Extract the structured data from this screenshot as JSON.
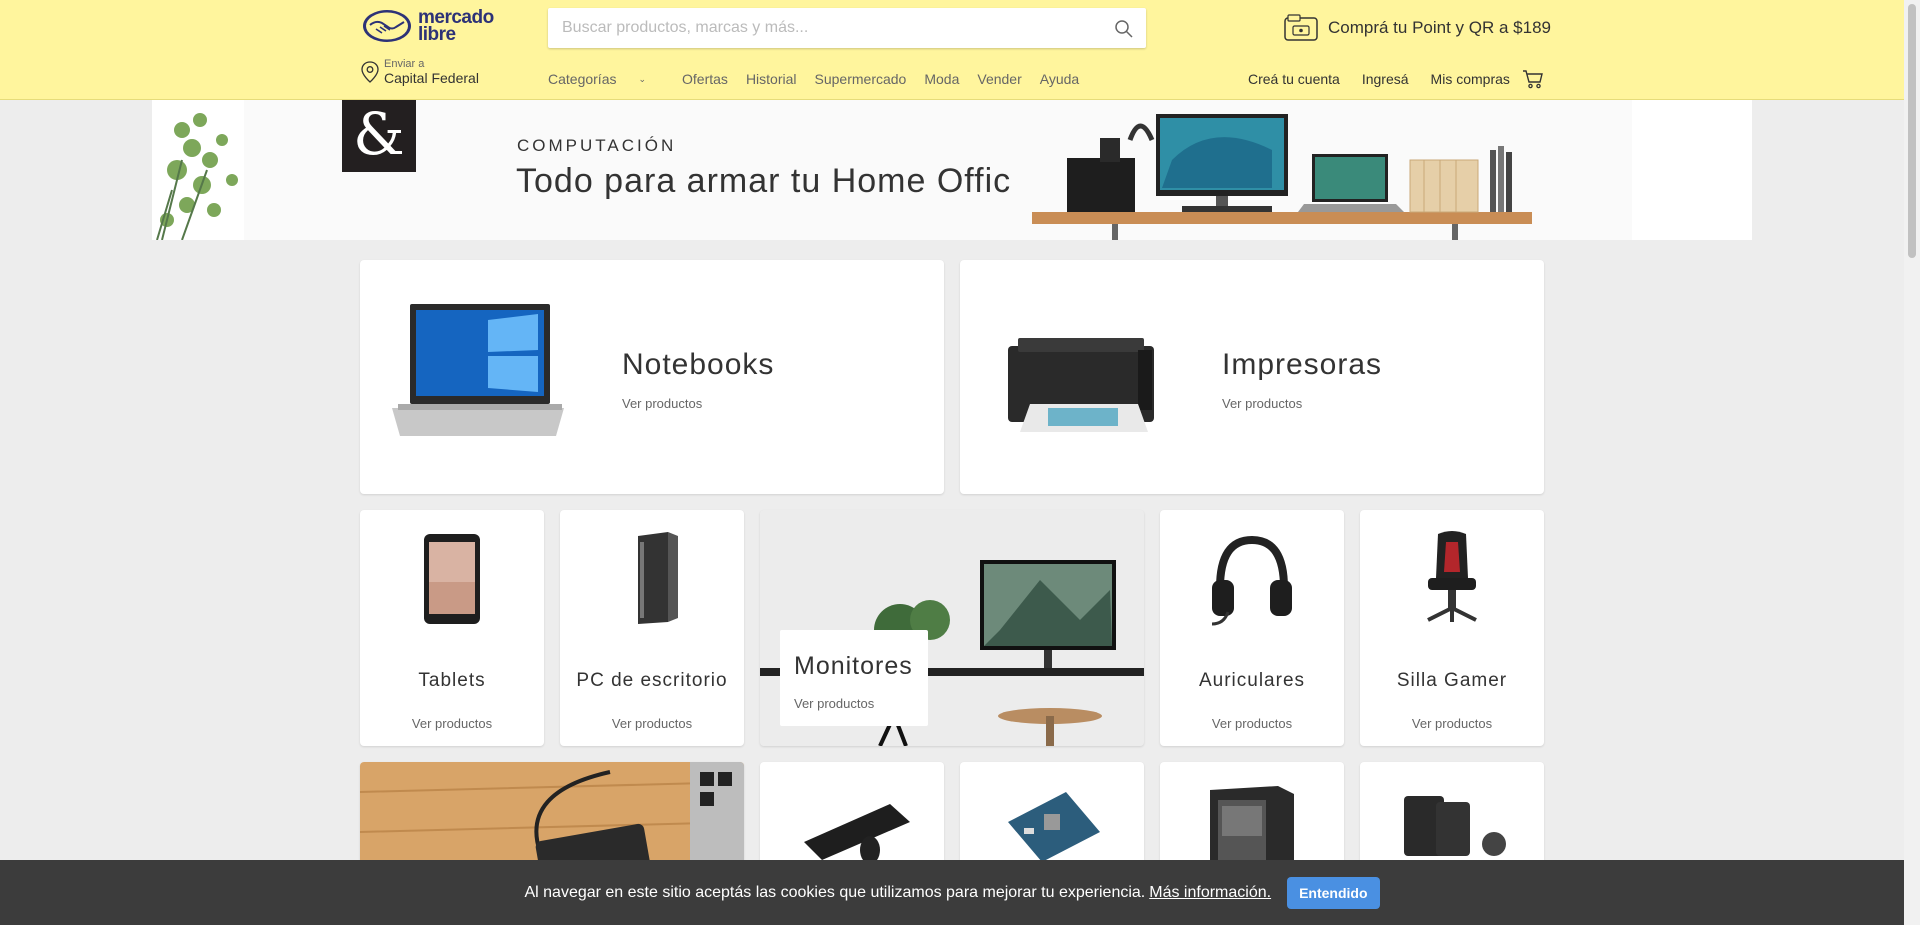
{
  "header": {
    "logo_line1": "mercado",
    "logo_line2": "libre",
    "search_placeholder": "Buscar productos, marcas y más...",
    "promo": "Comprá tu Point y QR a $189",
    "location_label": "Enviar a",
    "location_city": "Capital Federal",
    "nav": [
      "Categorías",
      "Ofertas",
      "Historial",
      "Supermercado",
      "Moda",
      "Vender",
      "Ayuda"
    ],
    "user_nav": [
      "Creá tu cuenta",
      "Ingresá",
      "Mis compras"
    ],
    "brand_color": "#fff59d"
  },
  "banner": {
    "kicker": "COMPUTACIÓN",
    "title": "Todo para armar tu Home Office",
    "ampersand": "&"
  },
  "cards": {
    "link_label": "Ver productos",
    "large": [
      {
        "title": "Notebooks",
        "icon": "laptop-icon"
      },
      {
        "title": "Impresoras",
        "icon": "printer-icon"
      }
    ],
    "small": [
      {
        "title": "Tablets",
        "icon": "tablet-icon"
      },
      {
        "title": "PC de escritorio",
        "icon": "desktop-pc-icon"
      },
      {
        "title": "Auriculares",
        "icon": "headset-icon"
      },
      {
        "title": "Silla Gamer",
        "icon": "gaming-chair-icon"
      }
    ],
    "featured": {
      "title": "Monitores"
    }
  },
  "cookie": {
    "text": "Al navegar en este sitio aceptás las cookies que utilizamos para mejorar tu experiencia.",
    "link": "Más información.",
    "button": "Entendido",
    "button_color": "#4a90e2"
  }
}
